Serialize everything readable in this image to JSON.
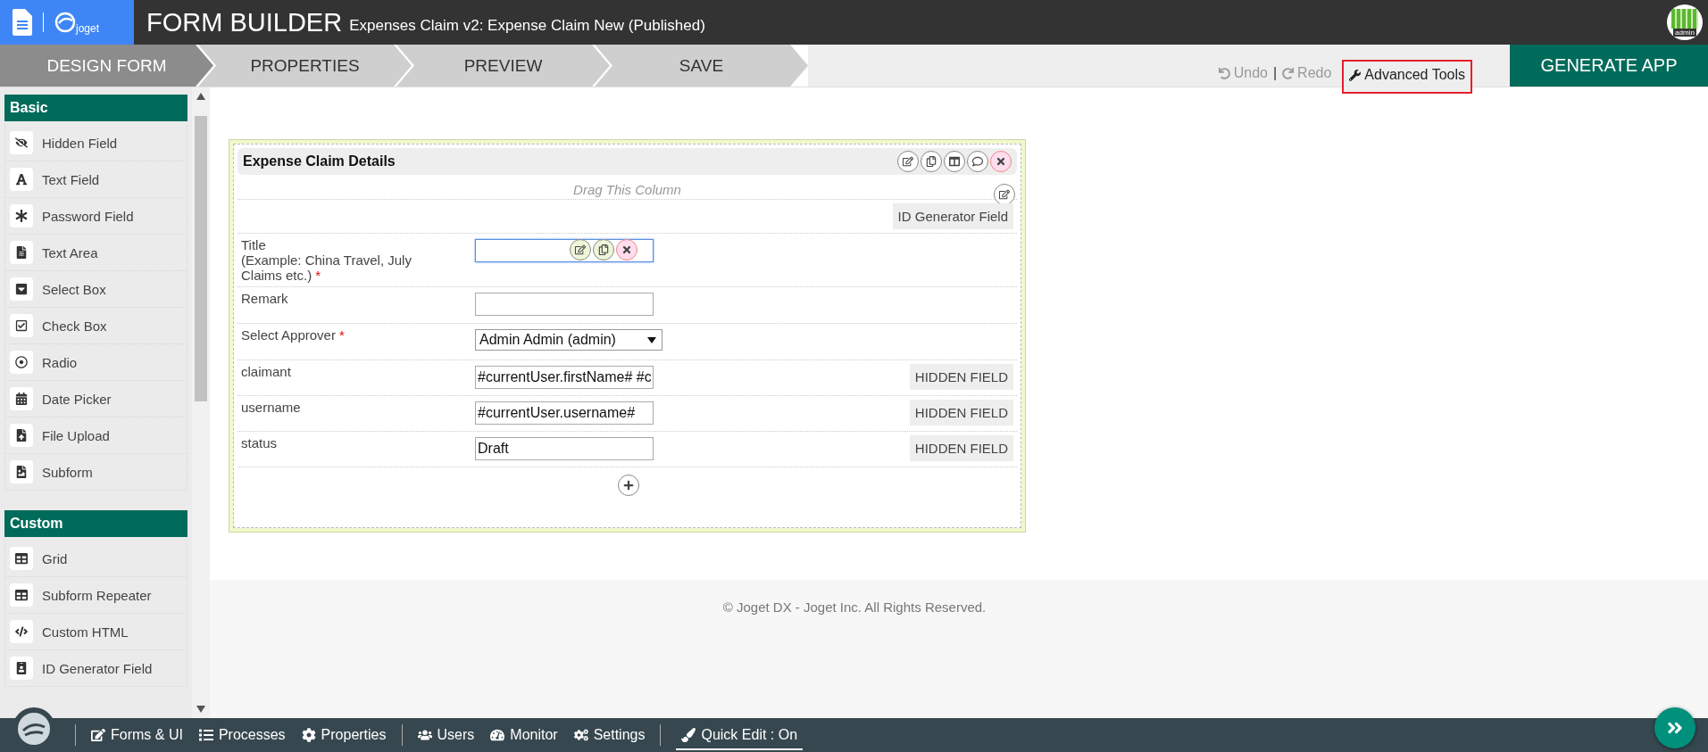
{
  "header": {
    "logo_text": "joget",
    "title": "FORM BUILDER",
    "subtitle": "Expenses Claim v2: Expense Claim New (Published)",
    "avatar_label": "admin"
  },
  "steps": [
    {
      "label": "DESIGN FORM",
      "selected": true
    },
    {
      "label": "PROPERTIES",
      "selected": false
    },
    {
      "label": "PREVIEW",
      "selected": false
    },
    {
      "label": "SAVE",
      "selected": false
    }
  ],
  "toolbar": {
    "undo": {
      "label": "Undo",
      "disabled": true
    },
    "separator": "|",
    "redo": {
      "label": "Redo",
      "disabled": true
    },
    "advanced": {
      "label": "Advanced Tools",
      "highlighted": true
    }
  },
  "generate_button": "GENERATE APP",
  "palette": [
    {
      "heading": "Basic",
      "items": [
        {
          "label": "Hidden Field",
          "kind": "hidden"
        },
        {
          "label": "Text Field",
          "kind": "textfield"
        },
        {
          "label": "Password Field",
          "kind": "password"
        },
        {
          "label": "Text Area",
          "kind": "textarea"
        },
        {
          "label": "Select Box",
          "kind": "select"
        },
        {
          "label": "Check Box",
          "kind": "checkbox"
        },
        {
          "label": "Radio",
          "kind": "radio"
        },
        {
          "label": "Date Picker",
          "kind": "date"
        },
        {
          "label": "File Upload",
          "kind": "upload"
        },
        {
          "label": "Subform",
          "kind": "subform"
        }
      ]
    },
    {
      "heading": "Custom",
      "items": [
        {
          "label": "Grid",
          "kind": "grid"
        },
        {
          "label": "Subform Repeater",
          "kind": "grid"
        },
        {
          "label": "Custom HTML",
          "kind": "code"
        },
        {
          "label": "ID Generator Field",
          "kind": "id"
        }
      ]
    }
  ],
  "form": {
    "section_title": "Expense Claim Details",
    "column_hint": "Drag This Column",
    "rows": [
      {
        "kind": "badge",
        "badge": "ID Generator Field"
      },
      {
        "kind": "text",
        "label": "Title",
        "note": "(Example: China Travel, July Claims etc.)",
        "required_mark": "*",
        "value": "",
        "focused": true
      },
      {
        "kind": "text",
        "label": "Remark",
        "value": "",
        "focused": false
      },
      {
        "kind": "select",
        "label": "Select Approver",
        "required_mark": "*",
        "value": "Admin Admin (admin)"
      },
      {
        "kind": "hidden",
        "label": "claimant",
        "value": "#currentUser.firstName# #c",
        "badge": "HIDDEN FIELD"
      },
      {
        "kind": "hidden",
        "label": "username",
        "value": "#currentUser.username#",
        "badge": "HIDDEN FIELD"
      },
      {
        "kind": "hidden",
        "label": "status",
        "value": "Draft",
        "badge": "HIDDEN FIELD"
      }
    ]
  },
  "footer": "© Joget DX - Joget Inc. All Rights Reserved.",
  "bottom_nav": [
    {
      "label": "Forms & UI",
      "kind": "edit",
      "divider_before": true
    },
    {
      "label": "Processes",
      "kind": "list",
      "divider_before": false
    },
    {
      "label": "Properties",
      "kind": "gear",
      "divider_before": false
    },
    {
      "label": "Users",
      "kind": "users",
      "divider_before": true
    },
    {
      "label": "Monitor",
      "kind": "gauge",
      "divider_before": false
    },
    {
      "label": "Settings",
      "kind": "gears",
      "divider_before": false
    }
  ],
  "quick_edit": {
    "label": "Quick Edit : On",
    "on": true
  }
}
